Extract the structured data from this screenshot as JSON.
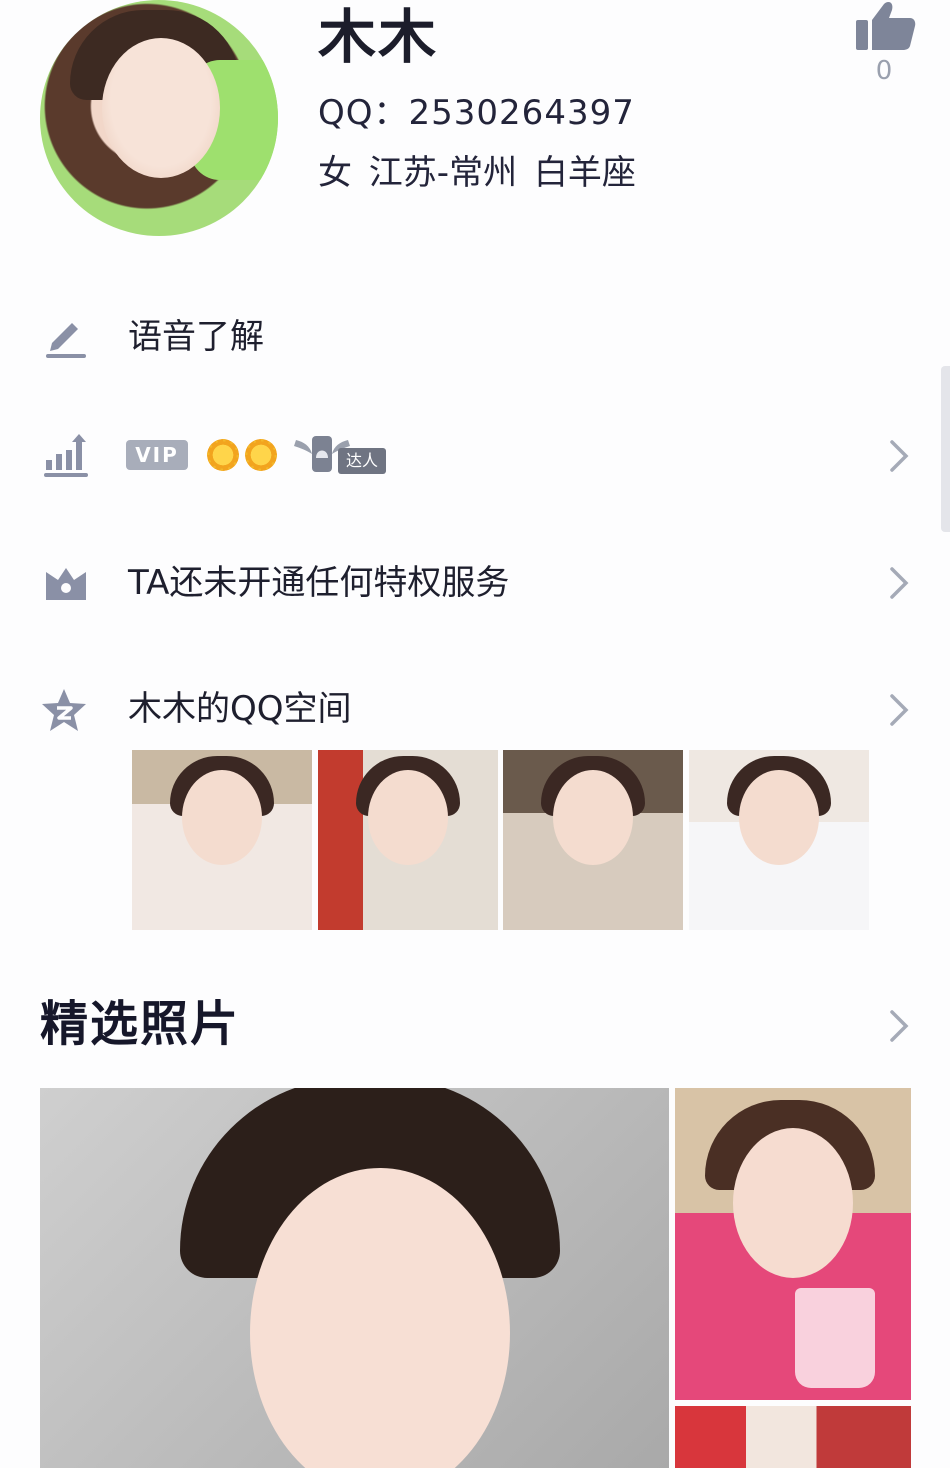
{
  "profile": {
    "name": "木木",
    "qq_line": "QQ：2530264397",
    "info_line": "女  江苏-常州  白羊座",
    "like_count": "0"
  },
  "rows": {
    "voice": {
      "label": "语音了解",
      "icon": "pencil-icon"
    },
    "badges": {
      "icon": "rank-chart-icon",
      "vip_label": "VIP",
      "suns": 2,
      "daren_label": "达人"
    },
    "privilege": {
      "label": "TA还未开通任何特权服务",
      "icon": "crown-icon"
    },
    "qzone": {
      "label": "木木的QQ空间",
      "icon": "qzone-star-icon",
      "thumbnail_count": 4
    }
  },
  "featured": {
    "title": "精选照片"
  },
  "colors": {
    "icon_gray": "#8a90a6",
    "text_dark": "#1c1d2b",
    "chevron": "#a5aab7"
  }
}
